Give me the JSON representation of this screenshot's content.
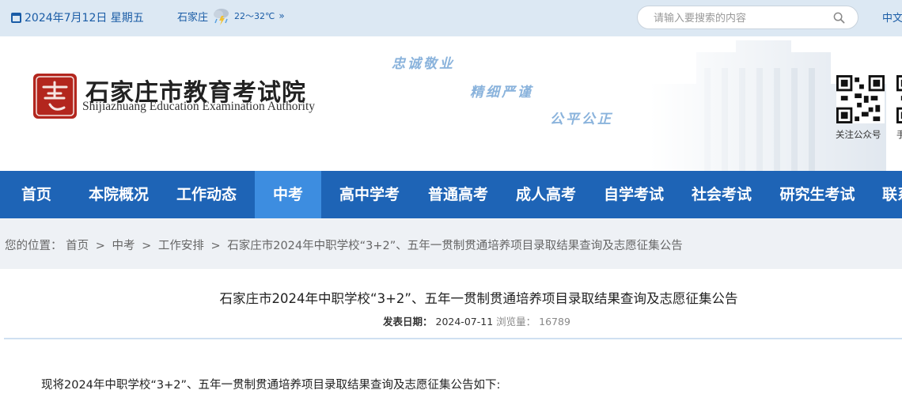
{
  "topbar": {
    "date": "2024年7月12日 星期五",
    "city": "石家庄",
    "temperature": "22～32℃",
    "weather_icon": "thunder-rain-cloud-icon",
    "more": "»",
    "search_placeholder": "请输入要搜索的内容",
    "language": "中文"
  },
  "brand": {
    "name_cn": "石家庄市教育考试院",
    "name_en": "Shijiazhuang Education Examination Authority",
    "mottos": [
      "忠诚敬业",
      "精细严谨",
      "公平公正"
    ],
    "qr_caption": "关注公众号",
    "qr2_caption": "手"
  },
  "colors": {
    "accent": "#1e64b6",
    "nav_active": "#3d8de0",
    "seal_red": "#b3261e"
  },
  "nav": {
    "items": [
      {
        "label": "首页"
      },
      {
        "label": "本院概况"
      },
      {
        "label": "工作动态"
      },
      {
        "label": "中考"
      },
      {
        "label": "高中学考"
      },
      {
        "label": "普通高考"
      },
      {
        "label": "成人高考"
      },
      {
        "label": "自学考试"
      },
      {
        "label": "社会考试"
      },
      {
        "label": "研究生考试"
      },
      {
        "label": "联系"
      }
    ],
    "active": "中考"
  },
  "breadcrumb": {
    "prefix": "您的位置：",
    "items": [
      "首页",
      "中考",
      "工作安排",
      "石家庄市2024年中职学校“3+2”、五年一贯制贯通培养项目录取结果查询及志愿征集公告"
    ],
    "separator": ">"
  },
  "article": {
    "title": "石家庄市2024年中职学校“3+2”、五年一贯制贯通培养项目录取结果查询及志愿征集公告",
    "date_label": "发表日期：",
    "date": "2024-07-11",
    "views_label": "浏览量：",
    "views": "16789",
    "intro": "现将2024年中职学校“3+2”、五年一贯制贯通培养项目录取结果查询及志愿征集公告如下:"
  }
}
